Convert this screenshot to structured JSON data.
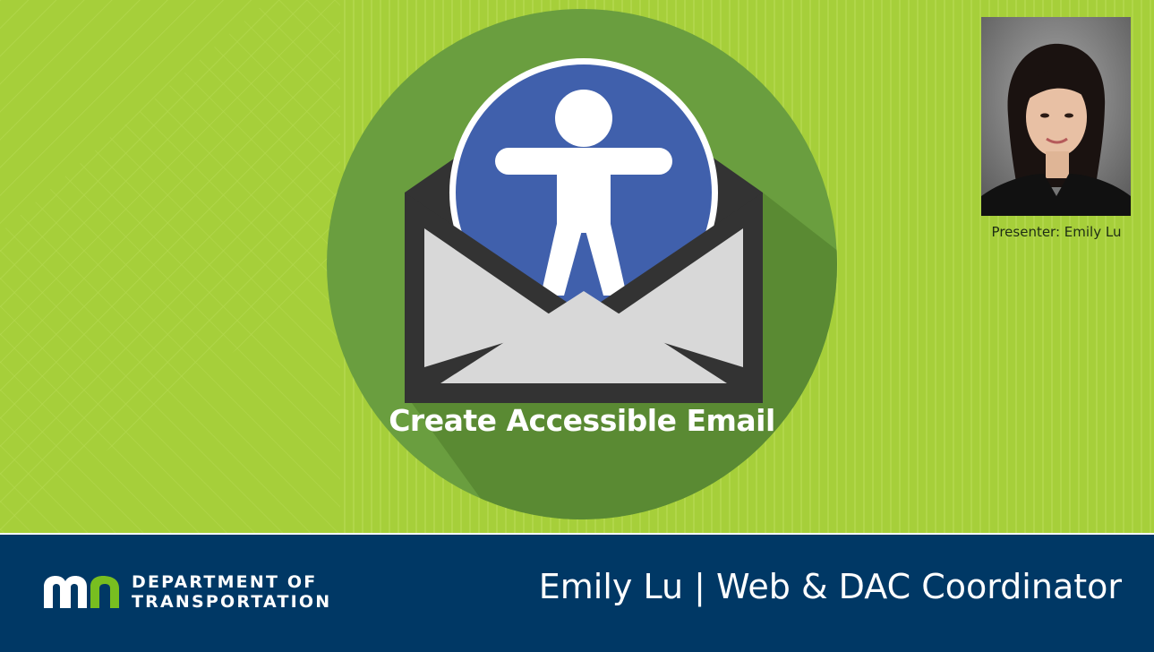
{
  "slide": {
    "title": "Create Accessible Email",
    "presenter_caption": "Presenter: Emily Lu",
    "footer": {
      "org_line1": "DEPARTMENT OF",
      "org_line2": "TRANSPORTATION",
      "presenter_line": "Emily Lu | Web & DAC Coordinator"
    }
  },
  "colors": {
    "background_green": "#a6cf3a",
    "circle_green": "#6a9e3f",
    "accessibility_blue": "#4060ac",
    "envelope_dark": "#333333",
    "envelope_light": "#d8d8d8",
    "footer_navy": "#003865",
    "logo_green": "#78be20"
  },
  "icons": {
    "emblem": "accessible-email-icon",
    "logo": "mn-logo-icon"
  }
}
